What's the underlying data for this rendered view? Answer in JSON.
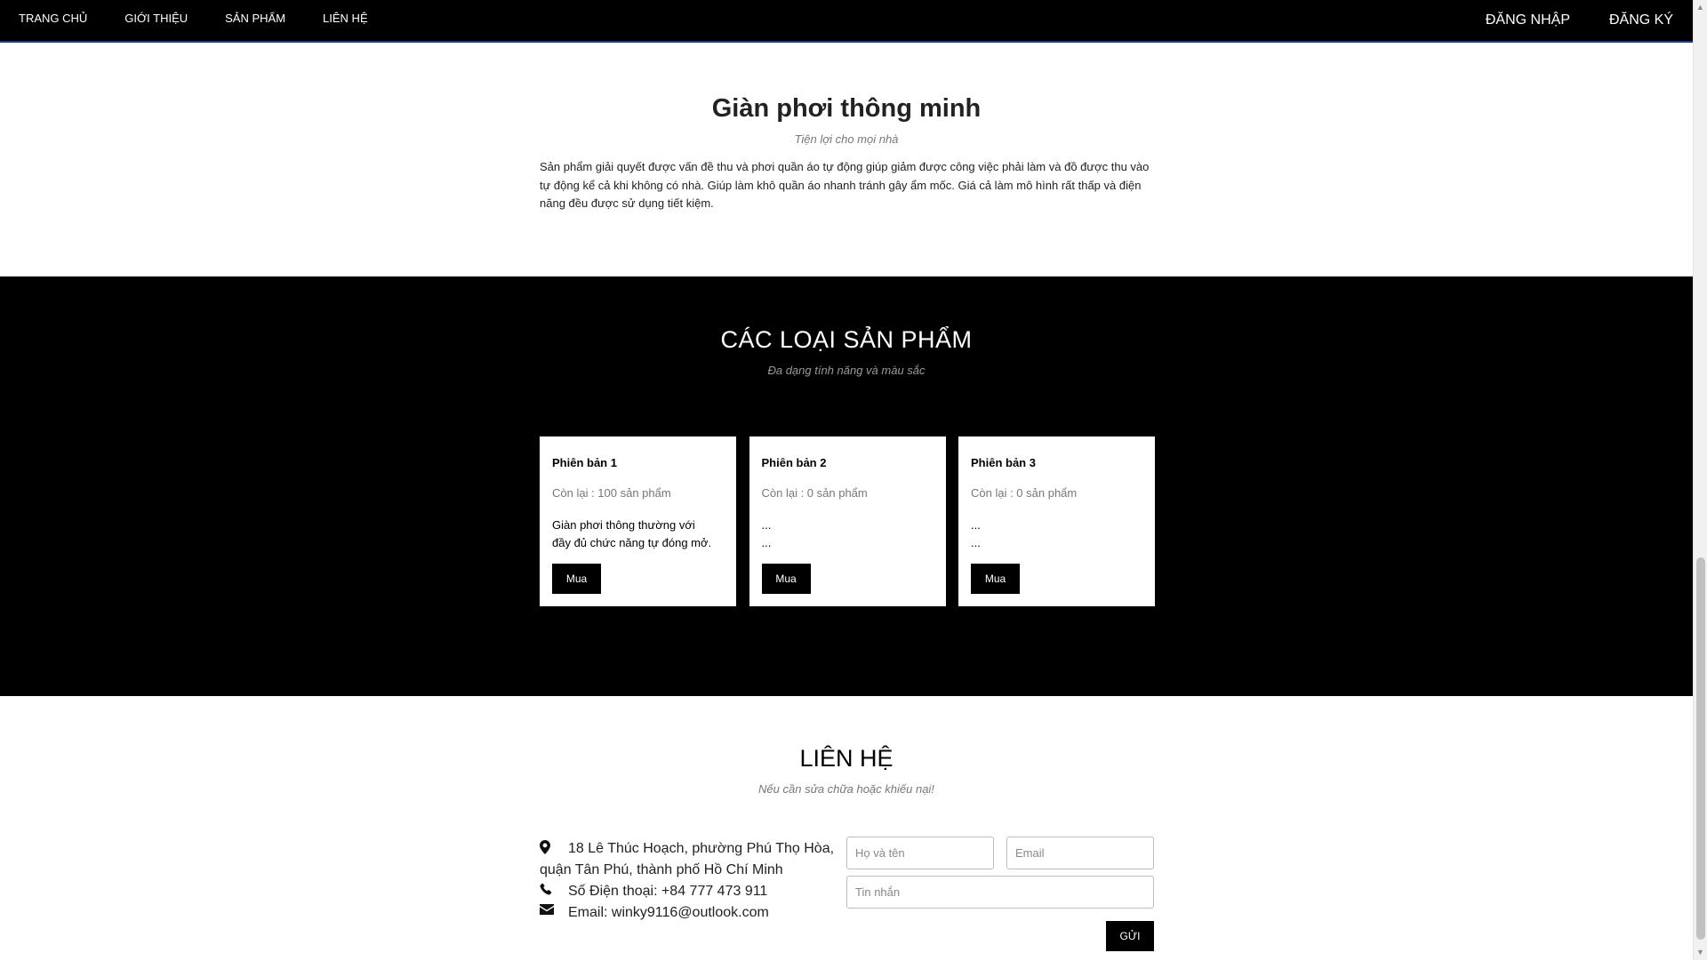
{
  "nav": {
    "left_items": [
      {
        "label": "TRANG CHỦ"
      },
      {
        "label": "GIỚI THIỆU"
      },
      {
        "label": "SẢN PHẨM"
      },
      {
        "label": "LIÊN HỆ"
      }
    ],
    "login_label": "ĐĂNG NHẬP",
    "register_label": "ĐĂNG KÝ"
  },
  "about": {
    "title": "Giàn phơi thông minh",
    "subtitle": "Tiện lợi cho mọi nhà",
    "text": "Sản phẩm giải quyết được vấn đề thu và phơi quần áo tự động giúp giảm được công việc phải làm và đồ được thu vào tự động kể cả khi không có nhà. Giúp làm khô quần áo nhanh tránh gây ẩm mốc. Giá cả làm mô hình rất thấp và điện năng đều được sử dụng tiết kiệm."
  },
  "products": {
    "title": "CÁC LOẠI SẢN PHẨM",
    "subtitle": "Đa dạng tính năng và màu sắc",
    "items": [
      {
        "name": "Phiên bản 1",
        "stock": "Còn lại : 100 sản phẩm",
        "desc_line1": "Giàn phơi thông thường với",
        "desc_line2": "đầy đủ chức năng tự đóng mở.",
        "buy_label": "Mua"
      },
      {
        "name": "Phiên bản 2",
        "stock": "Còn lại : 0 sản phẩm",
        "desc_line1": "...",
        "desc_line2": "...",
        "buy_label": "Mua"
      },
      {
        "name": "Phiên bản 3",
        "stock": "Còn lại : 0 sản phẩm",
        "desc_line1": "...",
        "desc_line2": "...",
        "buy_label": "Mua"
      }
    ]
  },
  "contact": {
    "title": "LIÊN HỆ",
    "subtitle": "Nếu cần sửa chữa hoặc khiếu nại!",
    "address_line1": "18 Lê Thúc Hoạch, phường Phú Thọ Hòa,",
    "address_line2": "quận Tân Phú, thành phố Hồ Chí Minh",
    "phone": "Số Điện thoại: +84 777 473 911",
    "email": "Email: winky9116@outlook.com",
    "form": {
      "name_placeholder": "Họ và tên",
      "email_placeholder": "Email",
      "message_placeholder": "Tin nhắn",
      "submit_label": "GỬI"
    }
  },
  "icons": {
    "address": "map-marker-icon",
    "phone": "phone-icon",
    "email": "envelope-icon"
  }
}
